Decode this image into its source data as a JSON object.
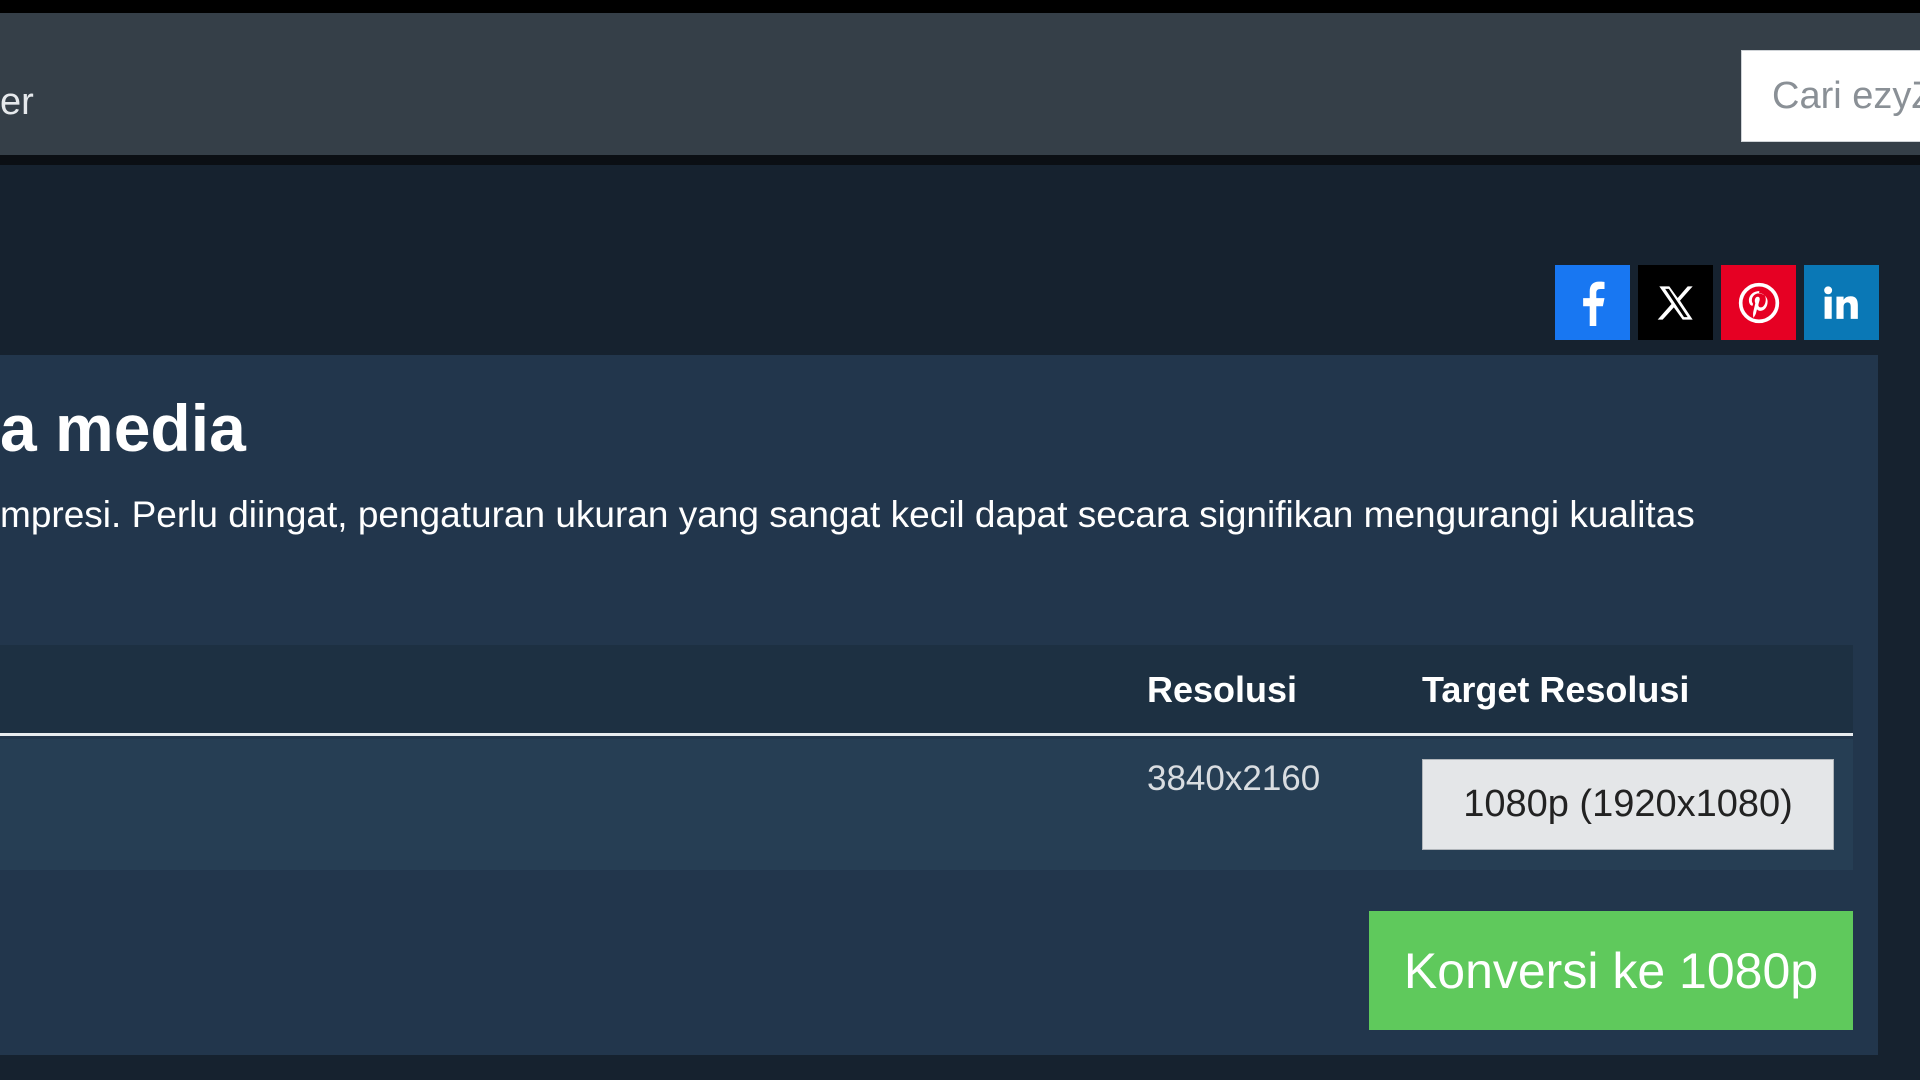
{
  "navbar": {
    "title_fragment": "er",
    "search_placeholder": "Cari ezyZ"
  },
  "social": {
    "items": [
      {
        "name": "facebook",
        "icon": "facebook-icon",
        "color": "#1877f2"
      },
      {
        "name": "x",
        "icon": "x-icon",
        "color": "#000000"
      },
      {
        "name": "pinterest",
        "icon": "pinterest-icon",
        "color": "#e60023"
      },
      {
        "name": "linkedin",
        "icon": "linkedin-icon",
        "color": "#0a78b6"
      }
    ]
  },
  "main": {
    "heading": "a media",
    "description": "mpresi. Perlu diingat, pengaturan ukuran yang sangat kecil dapat secara signifikan mengurangi kualitas"
  },
  "table": {
    "headers": [
      "Resolusi",
      "Target Resolusi"
    ],
    "rows": [
      {
        "resolution": "3840x2160",
        "target": "1080p (1920x1080)"
      }
    ]
  },
  "actions": {
    "convert_label": "Konversi ke 1080p"
  },
  "colors": {
    "convert_button": "#5fc95c",
    "panel": "#22364c",
    "navbar": "#353f48"
  }
}
